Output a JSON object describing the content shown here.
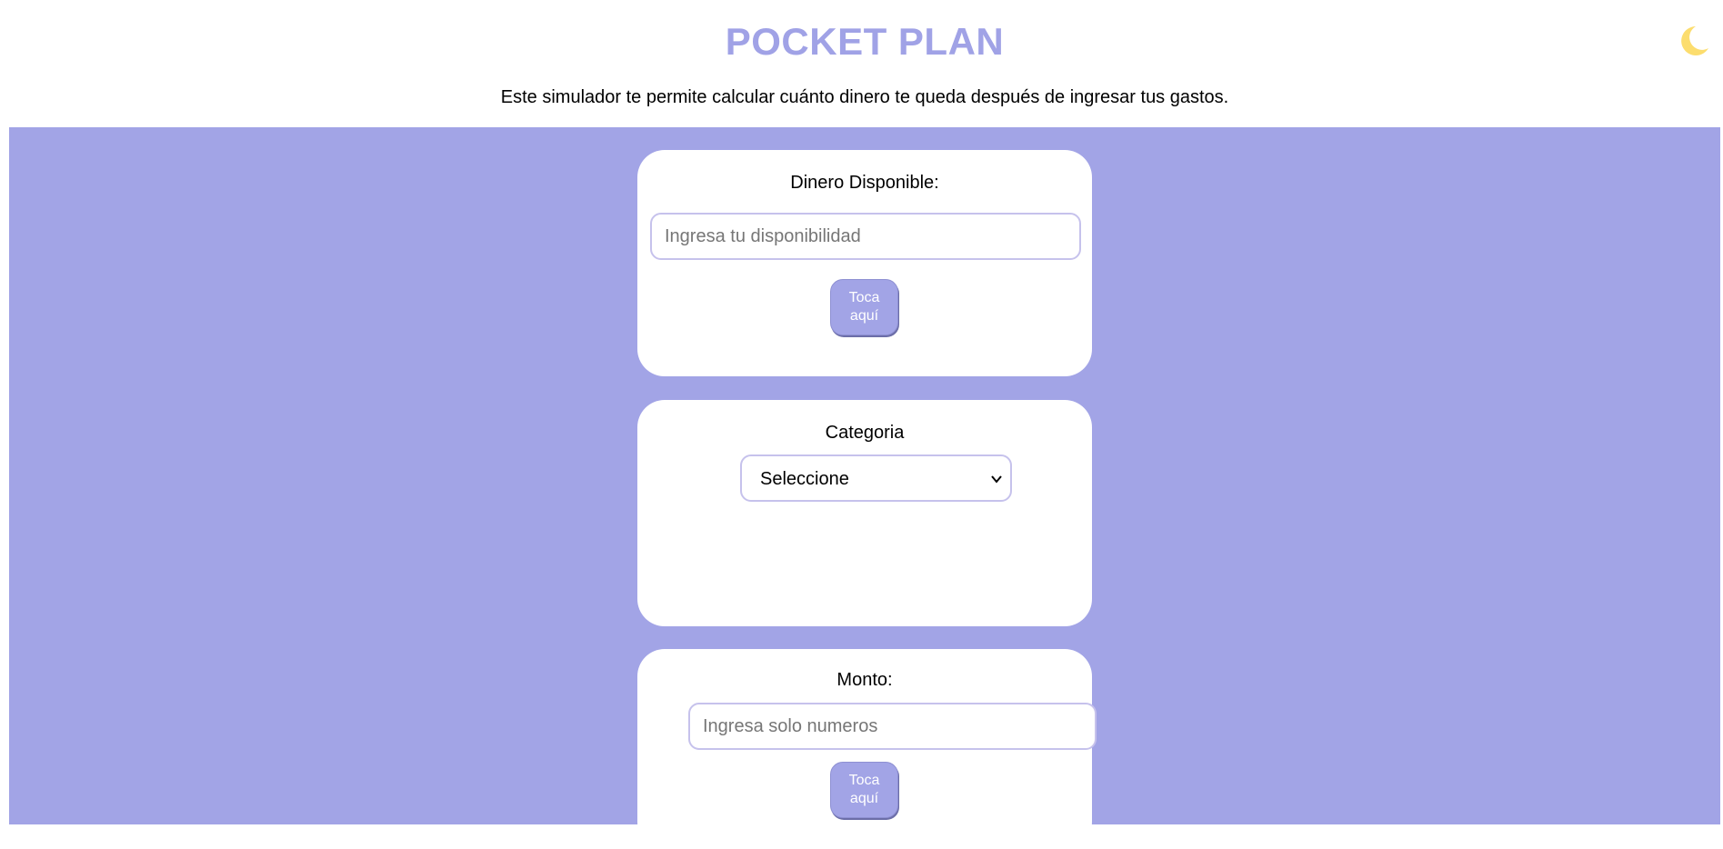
{
  "header": {
    "title": "POCKET PLAN",
    "subtitle": "Este simulador te permite calcular cuánto dinero te queda después de ingresar tus gastos."
  },
  "icons": {
    "theme_toggle": "moon-icon",
    "select_chevron": "chevron-down-icon"
  },
  "colors": {
    "accent": "#a2a4e6",
    "title": "#a0a2e6",
    "moon": "#fcdd6e",
    "input_border": "#c6c2ec"
  },
  "disponible": {
    "label": "Dinero Disponible:",
    "placeholder": "Ingresa tu disponibilidad",
    "button_label": "Toca aquí"
  },
  "categoria": {
    "label": "Categoria",
    "selected": "Seleccione"
  },
  "monto": {
    "label": "Monto:",
    "placeholder": "Ingresa solo numeros",
    "button_label": "Toca aquí"
  }
}
